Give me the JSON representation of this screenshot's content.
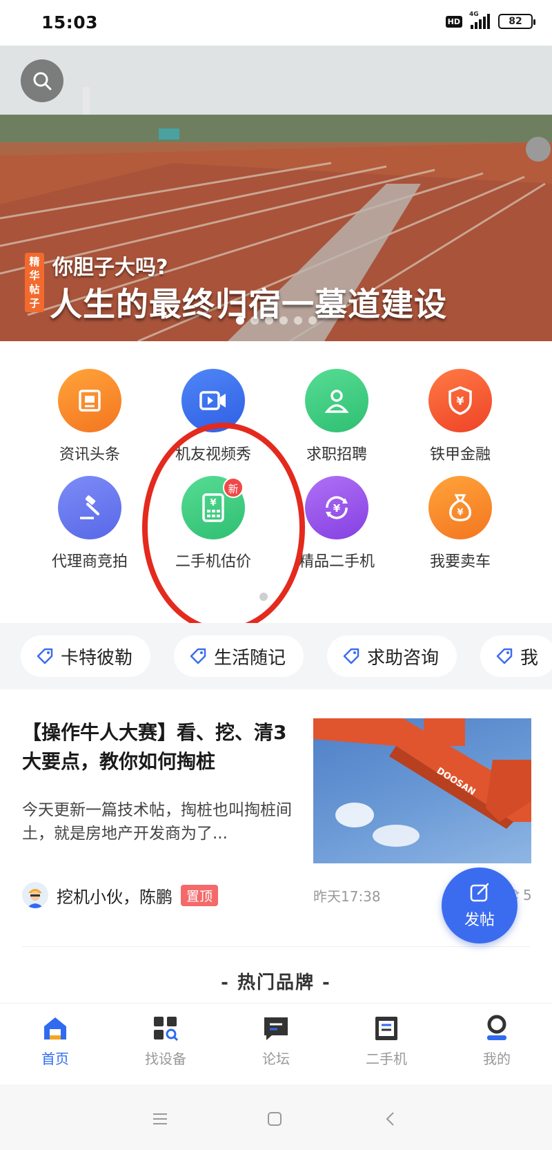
{
  "status_bar": {
    "time": "15:03",
    "hd": "HD",
    "network": "4G",
    "battery": "82"
  },
  "banner": {
    "tag": "精华帖子",
    "subtitle": "你胆子大吗?",
    "title": "人生的最终归宿一墓道建设",
    "dots": 6,
    "active_dot": 0,
    "icon": "search-icon"
  },
  "grid": {
    "items": [
      {
        "label": "资讯头条",
        "icon": "news-icon",
        "color": "#f7882c"
      },
      {
        "label": "机友视频秀",
        "icon": "video-icon",
        "color": "#3e74ef"
      },
      {
        "label": "求职招聘",
        "icon": "job-icon",
        "color": "#3fcf82"
      },
      {
        "label": "铁甲金融",
        "icon": "finance-shield-icon",
        "color": "#f4593b"
      },
      {
        "label": "代理商竞拍",
        "icon": "auction-hammer-icon",
        "color": "#6c7cf0"
      },
      {
        "label": "二手机估价",
        "icon": "price-calculator-icon",
        "color": "#3fcf82",
        "badge": "新"
      },
      {
        "label": "精品二手机",
        "icon": "exchange-yuan-icon",
        "color": "#9a55ea"
      },
      {
        "label": "我要卖车",
        "icon": "money-bag-icon",
        "color": "#f7882c"
      }
    ]
  },
  "tags": [
    "卡特彼勒",
    "生活随记",
    "求助咨询",
    "我"
  ],
  "article": {
    "title": "【操作牛人大赛】看、挖、清3大要点，教你如何掏桩",
    "summary": "今天更新一篇技术帖，掏桩也叫掏桩间土，就是房地产开发商为了...",
    "author": "挖机小伙，陈鹏",
    "pin": "置顶",
    "time": "昨天17:38",
    "share_count": "5",
    "image_brand": "DOOSAN"
  },
  "fab": {
    "label": "发帖",
    "icon": "edit-icon"
  },
  "section_title": "- 热门品牌 -",
  "nav": {
    "items": [
      {
        "label": "首页",
        "icon": "home-icon",
        "active": true
      },
      {
        "label": "找设备",
        "icon": "find-equipment-icon",
        "active": false
      },
      {
        "label": "论坛",
        "icon": "forum-icon",
        "active": false
      },
      {
        "label": "二手机",
        "icon": "used-machine-icon",
        "active": false
      },
      {
        "label": "我的",
        "icon": "profile-icon",
        "active": false
      }
    ]
  },
  "colors": {
    "accent": "#3b6cf0",
    "annotation": "#e42a1d",
    "pin": "#f46a6a"
  }
}
